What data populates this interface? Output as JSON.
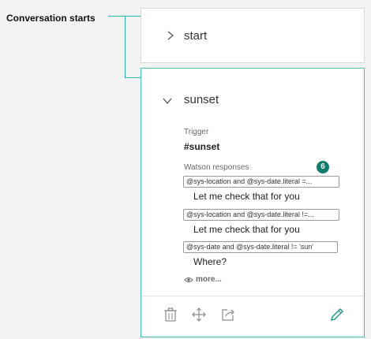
{
  "flow": {
    "label": "Conversation starts"
  },
  "nodes": [
    {
      "title": "start"
    },
    {
      "title": "sunset",
      "trigger_label": "Trigger",
      "trigger_value": "#sunset",
      "responses_label": "Watson responses",
      "responses_count": "6",
      "responses": [
        {
          "condition": "@sys-location and @sys-date.literal =...",
          "text": "Let me check that for you"
        },
        {
          "condition": "@sys-location and @sys-date.literal !=...",
          "text": "Let me check that for you"
        },
        {
          "condition": "@sys-date and @sys-date.literal != 'sun'",
          "text": "Where?"
        }
      ],
      "more_label": "more..."
    }
  ],
  "toolbar": {
    "icons": [
      "trash-icon",
      "move-icon",
      "jump-to-icon",
      "edit-icon"
    ]
  },
  "colors": {
    "accent": "#42c3b1",
    "badge": "#0f7d6a",
    "edit_icon": "#1a9a85"
  }
}
